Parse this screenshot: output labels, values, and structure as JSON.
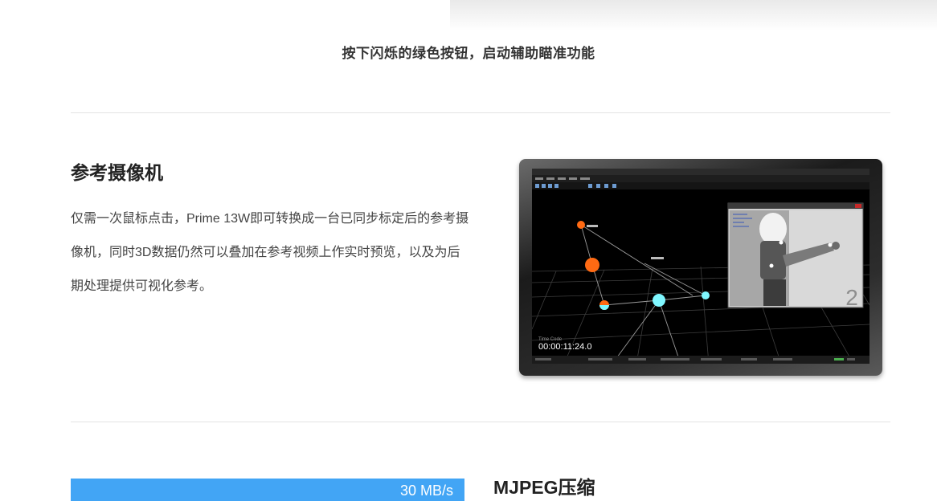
{
  "caption": "按下闪烁的绿色按钮，启动辅助瞄准功能",
  "reference_camera": {
    "title": "参考摄像机",
    "body": "仅需一次鼠标点击，Prime 13W即可转换成一台已同步标定后的参考摄像机，同时3D数据仍然可以叠加在参考视频上作实时预览，以及为后期处理提供可视化参考。"
  },
  "software_screen": {
    "timecode_label": "Time Code",
    "timecode": "00:00:11:24.0",
    "camera_number": "2"
  },
  "mjpeg": {
    "title": "MJPEG压缩",
    "bar_label": "30 MB/s"
  },
  "colors": {
    "accent_blue": "#42a5f5",
    "marker_orange": "#ff6a13",
    "marker_cyan": "#7ff7ff"
  }
}
